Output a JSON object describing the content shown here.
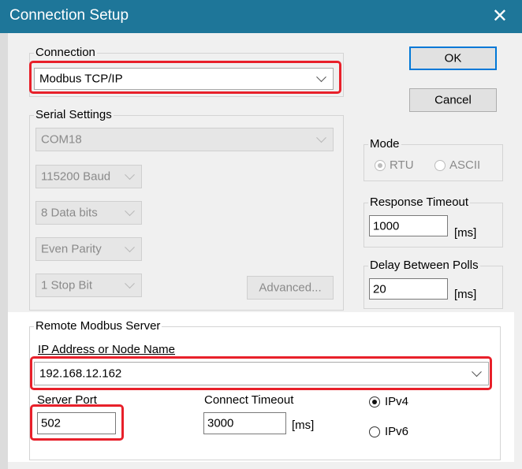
{
  "window": {
    "title": "Connection Setup",
    "close_glyph": "✕"
  },
  "connection": {
    "legend": "Connection",
    "selected": "Modbus TCP/IP"
  },
  "buttons": {
    "ok": "OK",
    "cancel": "Cancel"
  },
  "serial": {
    "legend": "Serial Settings",
    "port": "COM18",
    "baud": "115200 Baud",
    "data_bits": "8 Data bits",
    "parity": "Even Parity",
    "stop_bits": "1 Stop Bit",
    "advanced_label": "Advanced..."
  },
  "mode": {
    "legend": "Mode",
    "rtu_label": "RTU",
    "ascii_label": "ASCII",
    "selected": "RTU"
  },
  "response_timeout": {
    "legend": "Response Timeout",
    "value": "1000",
    "unit": "[ms]"
  },
  "delay_polls": {
    "legend": "Delay Between Polls",
    "value": "20",
    "unit": "[ms]"
  },
  "remote": {
    "legend": "Remote Modbus Server",
    "ip_label": "IP Address or Node Name",
    "ip_value": "192.168.12.162",
    "port_label": "Server Port",
    "port_value": "502",
    "connect_timeout_label": "Connect Timeout",
    "connect_timeout_value": "3000",
    "connect_timeout_unit": "[ms]",
    "ipv4_label": "IPv4",
    "ipv6_label": "IPv6",
    "ip_version_selected": "IPv4"
  },
  "colors": {
    "titlebar": "#1e7699",
    "highlight": "#e8202a",
    "focus_border": "#0078d7"
  }
}
